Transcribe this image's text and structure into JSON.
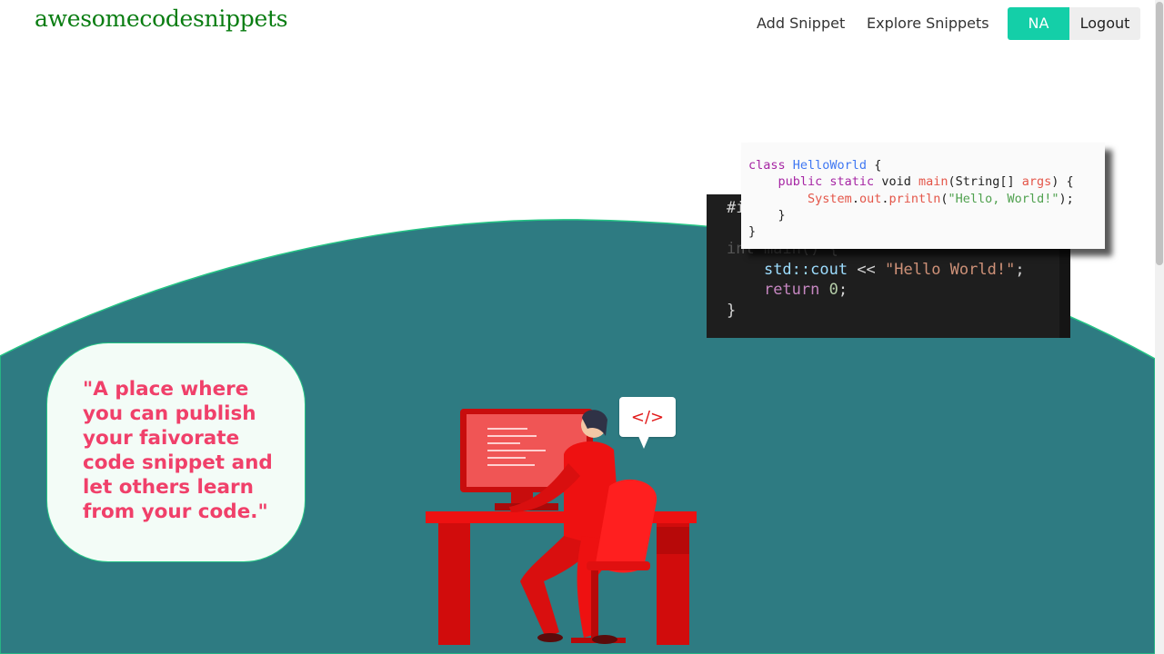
{
  "navbar": {
    "brand": "awesomecodesnippets",
    "links": [
      {
        "label": "Add Snippet"
      },
      {
        "label": "Explore Snippets"
      }
    ],
    "user_initials": "NA",
    "logout_label": "Logout"
  },
  "hero": {
    "quote": "\"A place where you can publish your faivorate code snippet and let others learn from your code.\"",
    "code_bubble_icon": "</>",
    "colors": {
      "wave": "#2e7b82",
      "accent": "#14cfa8",
      "quote_text": "#f0406a",
      "brand": "#0a7d12",
      "figure": "#ee1111"
    }
  },
  "code_cards": {
    "cpp": {
      "line1": "#i",
      "line2": "int main() {",
      "line3_fn": "std::cout",
      "line3_op": " << ",
      "line3_str": "\"Hello World!\"",
      "line3_end": ";",
      "line4_kw": "return",
      "line4_num": "0",
      "line4_end": ";",
      "line5": "}"
    },
    "java": {
      "l1_kw": "class",
      "l1_cls": "HelloWorld",
      "l1_end": " {",
      "l2_kw": "public static",
      "l2_type": " void ",
      "l2_fn": "main",
      "l2_args_open": "(String[] ",
      "l2_arg": "args",
      "l2_end": ") {",
      "l3_cls": "System",
      "l3_dot1": ".",
      "l3_out": "out",
      "l3_dot2": ".",
      "l3_fn": "println",
      "l3_open": "(",
      "l3_str": "\"Hello, World!\"",
      "l3_end": ");",
      "l4": "}",
      "l5": "}"
    }
  }
}
